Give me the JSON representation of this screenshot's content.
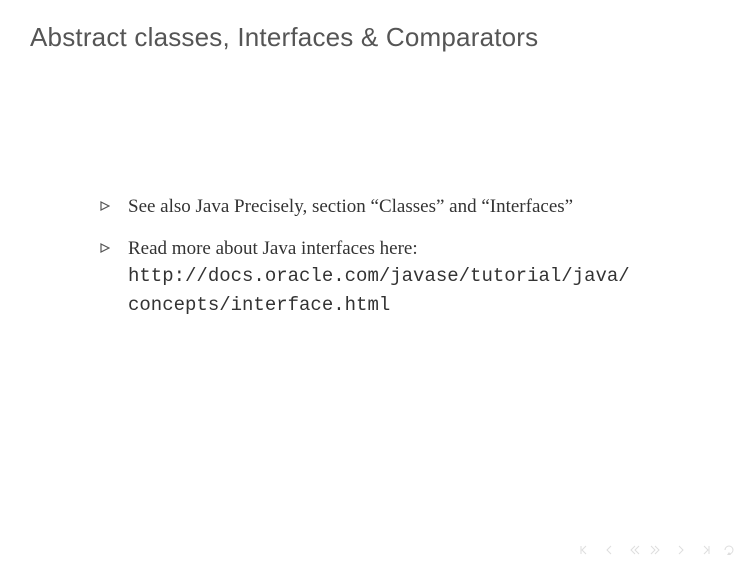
{
  "title": "Abstract classes, Interfaces & Comparators",
  "items": [
    {
      "text": "See also Java Precisely, section “Classes” and “Interfaces”"
    },
    {
      "text": "Read more about Java interfaces here:",
      "url_line1": "http://docs.oracle.com/javase/tutorial/java/",
      "url_line2": "concepts/interface.html"
    }
  ]
}
